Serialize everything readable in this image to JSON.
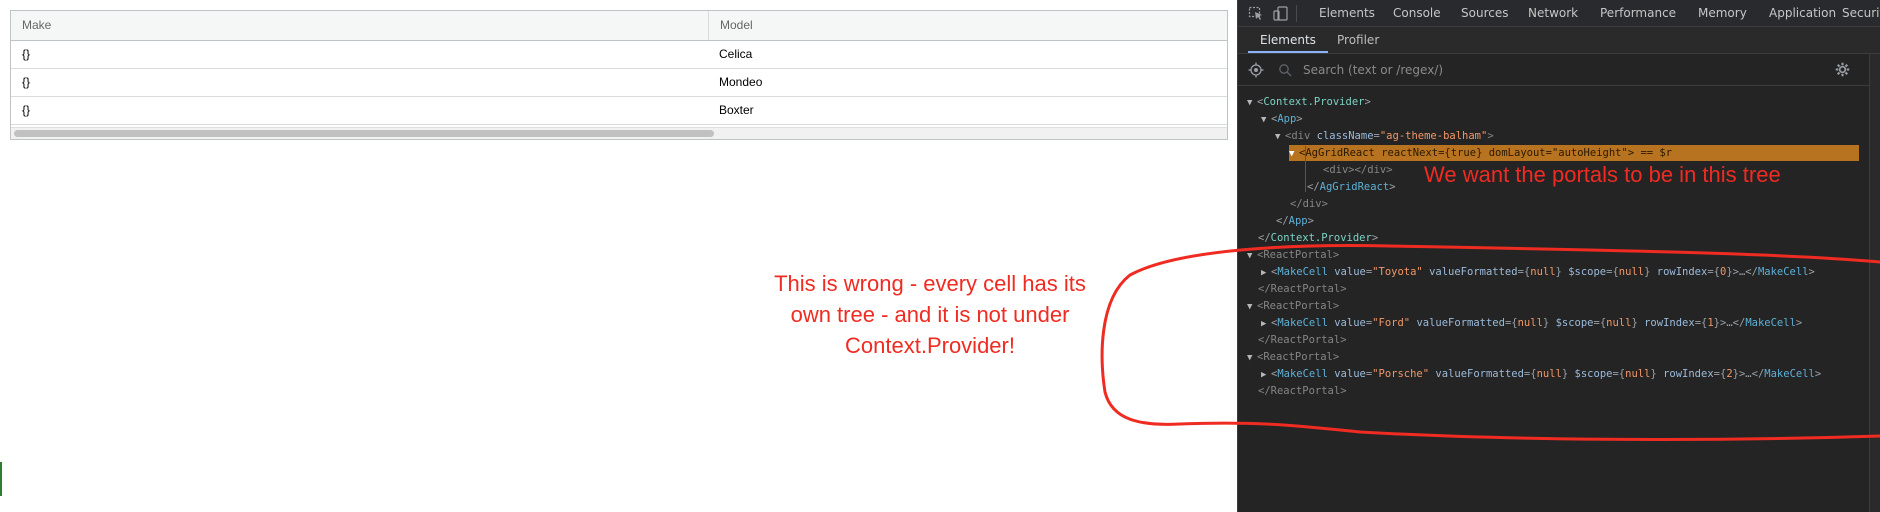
{
  "grid": {
    "columns": [
      "Make",
      "Model"
    ],
    "rows": [
      {
        "make": "{}",
        "model": "Celica"
      },
      {
        "make": "{}",
        "model": "Mondeo"
      },
      {
        "make": "{}",
        "model": "Boxter"
      }
    ]
  },
  "annotations": {
    "wrong_lines": [
      "This is wrong - every cell has its",
      "own tree - and it is not under",
      "Context.Provider!"
    ],
    "tree_note": "We want the portals to be in this tree",
    "color": "#ef2b22"
  },
  "devtools": {
    "top_tabs": [
      "Elements",
      "Console",
      "Sources",
      "Network",
      "Performance",
      "Memory",
      "Application",
      "Securit"
    ],
    "sub_tabs": [
      "Elements",
      "Profiler"
    ],
    "active_sub_tab": "Elements",
    "search_placeholder": "Search (text or /regex/)",
    "icons": [
      "inspect-icon",
      "device-toggle-icon",
      "locate-icon",
      "search-icon",
      "gear-icon"
    ],
    "tree": {
      "context_provider": "Context.Provider",
      "app": "App",
      "div_tag": "div",
      "classname_attr": "className",
      "classname_val": "\"ag-theme-balham\"",
      "aggrid": "AgGridReact",
      "react_next_attr": "reactNext",
      "react_next_val": "true",
      "dom_layout_attr": "domLayout",
      "dom_layout_val": "\"autoHeight\"",
      "dollar_r": "== $r",
      "inner_div": "<div></div>",
      "portal": "ReactPortal",
      "make_cell": "MakeCell",
      "portals": [
        {
          "value": "\"Toyota\"",
          "row_index": "0"
        },
        {
          "value": "\"Ford\"",
          "row_index": "1"
        },
        {
          "value": "\"Porsche\"",
          "row_index": "2"
        }
      ],
      "value_attr": "value",
      "value_formatted_attr": "valueFormatted",
      "scope_attr": "$scope",
      "row_index_attr": "rowIndex",
      "null_val": "null",
      "ellipsis": "…"
    },
    "colors": {
      "selected_row": "#b7731f",
      "background": "#242424",
      "tag": "#5db0d7",
      "attr_value": "#f29766"
    }
  }
}
